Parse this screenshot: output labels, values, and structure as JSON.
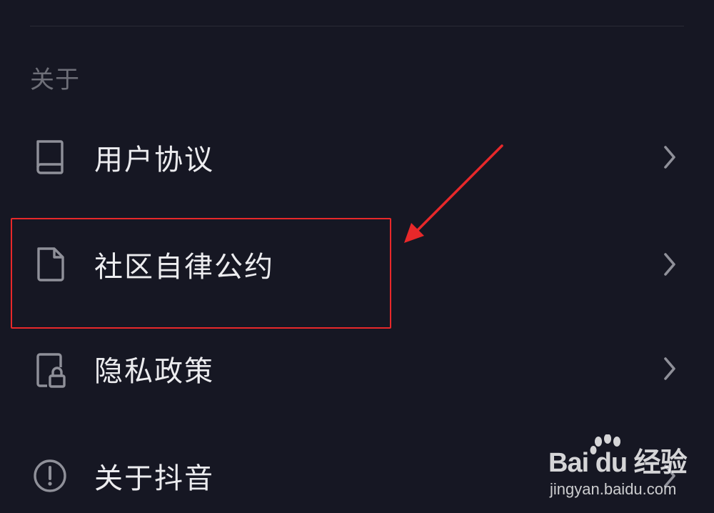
{
  "section": {
    "title": "关于"
  },
  "menu": {
    "items": [
      {
        "label": "用户协议",
        "icon": "book-icon"
      },
      {
        "label": "社区自律公约",
        "icon": "document-icon"
      },
      {
        "label": "隐私政策",
        "icon": "privacy-lock-icon"
      },
      {
        "label": "关于抖音",
        "icon": "info-circle-icon"
      }
    ]
  },
  "annotation": {
    "color": "#e8282a",
    "highlighted_item": "社区自律公约"
  },
  "watermark": {
    "logo_text": "Bai du 经验",
    "url": "jingyan.baidu.com"
  },
  "colors": {
    "background": "#161723",
    "text_primary": "#ececef",
    "text_secondary": "#6e6f78",
    "icon": "#8f9099"
  }
}
